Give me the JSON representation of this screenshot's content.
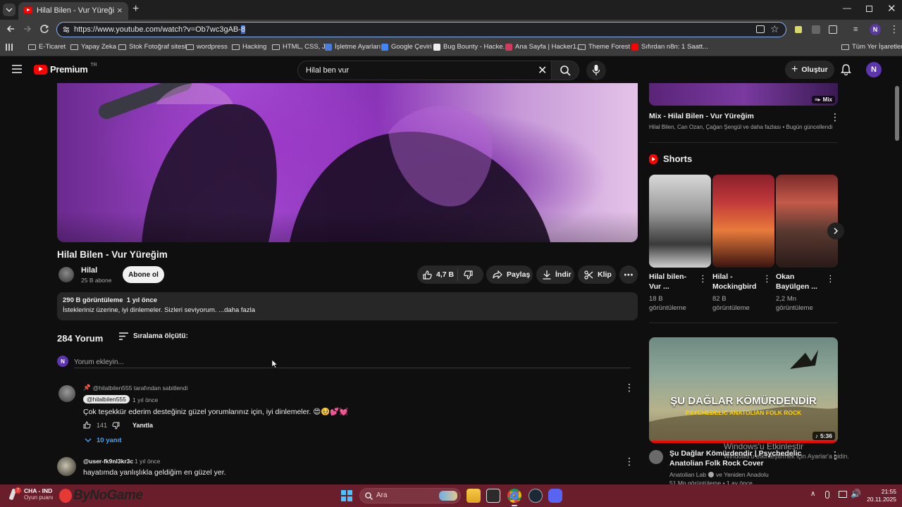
{
  "browser": {
    "tab_title": "Hilal Bilen - Vur Yüreğim - YouT",
    "url_main": "https://www.youtube.com/watch?v=Ob7wc3gAB-",
    "url_selected": "8",
    "bookmarks": [
      "E-Ticaret",
      "Yapay Zeka",
      "Stok Fotoğraf sitesi",
      "wordpress",
      "Hacking",
      "HTML, CSS, JS",
      "İşletme Ayarları",
      "Google Çeviri",
      "Bug Bounty - Hacke...",
      "Ana Sayfa | Hacker1...",
      "Theme Forest",
      "Sıfırdan n8n: 1 Saatt..."
    ],
    "all_bookmarks": "Tüm Yer İşaretleri"
  },
  "yt": {
    "logo_text": "Premium",
    "logo_badge": "TR",
    "search_value": "Hilal ben vur",
    "create_label": "Oluştur",
    "avatar_letter": "N"
  },
  "video": {
    "title": "Hilal Bilen - Vur Yüreğim",
    "channel": "Hilal",
    "subscribers": "25 B abone",
    "subscribe_label": "Abone ol",
    "likes": "4,7 B",
    "share_label": "Paylaş",
    "download_label": "İndir",
    "clip_label": "Klip",
    "views_line": "290 B görüntüleme  1 yıl önce",
    "desc_line": "İstekleriniz üzerine, iyi dinlemeler. Sizleri seviyorum. ...daha fazla"
  },
  "comments": {
    "count_label": "284 Yorum",
    "sort_label": "Sıralama ölçütü:",
    "add_placeholder": "Yorum ekleyin...",
    "items": [
      {
        "pinned": "@hilalbilen555 tarafından sabitlendi",
        "author": "@hilalbilen555",
        "time": "1 yıl önce",
        "text": "Çok teşekkür ederim desteğiniz güzel yorumlarınız için, iyi dinlemeler. 😍🥹💕💓",
        "likes": "141",
        "reply_label": "Yanıtla",
        "replies": "10 yanıt"
      },
      {
        "author": "@user-fk9nl3kr3c",
        "time": "1 yıl önce",
        "text": "hayatımda yanlışlıkla geldiğim en güzel yer."
      }
    ]
  },
  "sidebar": {
    "mix_badge": "Mix",
    "mix_title": "Mix - Hilal Bilen - Vur Yüreğim",
    "mix_sub": "Hilal Bilen, Can Ozan, Çağan Şengül ve daha fazlası • Bugün güncellendi",
    "shorts_title": "Shorts",
    "shorts": [
      {
        "title": "Hilal bilen- Vur ...",
        "views": "18 B görüntüleme"
      },
      {
        "title": "Hilal - Mockingbird",
        "views": "82 B görüntüleme"
      },
      {
        "title": "Okan Bayülgen ...",
        "views": "2,2 Mn görüntüleme"
      }
    ],
    "video_thumb_title": "ŞU DAĞLAR KÖMÜRDENDİR",
    "video_thumb_sub": "PSYCHEDELIC ANATOLIAN FOLK ROCK",
    "video_duration": "5:36",
    "video_title": "Şu Dağlar Kömürdendir | Psychedelic Anatolian Folk Rock Cover",
    "video_channel": "Anatolian Lab",
    "video_channel_extra": "ve Yeniden Anadolu",
    "video_meta": "51 Mn görüntüleme • 1 ay önce"
  },
  "watermark": {
    "line1": "Windows'u Etkinleştir",
    "line2": "Windows'u etkinleştirmek için Ayarlar'a gidin."
  },
  "taskbar": {
    "weather_title": "CHA - IND",
    "weather_sub": "Oyun puanı",
    "weather_badge": "7",
    "logo_text": "ByNoGame",
    "search_placeholder": "Ara",
    "time": "21:55",
    "date": "20.11.2025"
  },
  "colors": {
    "yt_red": "#ff0000",
    "taskbar": "#6a1e2b",
    "link_blue": "#3ea6ff"
  }
}
